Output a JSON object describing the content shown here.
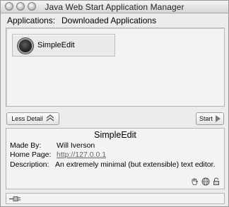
{
  "window": {
    "title": "Java Web Start Application Manager"
  },
  "appbar": {
    "label": "Applications:",
    "menu_value": "Downloaded Applications"
  },
  "apps": [
    {
      "name": "SimpleEdit"
    }
  ],
  "buttons": {
    "less_detail": "Less Detail",
    "start": "Start"
  },
  "details": {
    "title": "SimpleEdit",
    "made_by_label": "Made By:",
    "made_by": "Will Iverson",
    "home_page_label": "Home Page:",
    "home_page": "http://127.0.0.1",
    "description_label": "Description:",
    "description": "An extremely minimal (but extensible) text editor."
  },
  "icons": {
    "window_buttons": [
      "close-icon",
      "minimize-icon",
      "zoom-icon"
    ],
    "app": "app-icon",
    "less_detail": "double-chevron-up-icon",
    "start": "play-triangle-icon",
    "details": [
      "hand-icon",
      "globe-icon",
      "lock-icon"
    ],
    "status": "plug-icon"
  }
}
